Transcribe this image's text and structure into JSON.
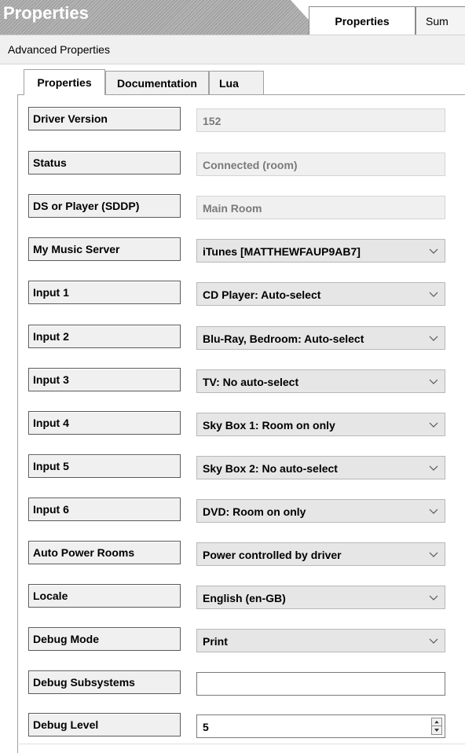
{
  "header": {
    "title": "Properties",
    "tabs": [
      {
        "label": "Properties",
        "active": true
      },
      {
        "label": "Sum",
        "active": false
      }
    ]
  },
  "subheader": {
    "label": "Advanced Properties"
  },
  "inner_tabs": [
    {
      "label": "Properties",
      "active": true
    },
    {
      "label": "Documentation",
      "active": false
    },
    {
      "label": "Lua",
      "active": false
    }
  ],
  "properties": [
    {
      "label": "Driver Version",
      "value": "152",
      "control": "readonly"
    },
    {
      "label": "Status",
      "value": "Connected (room)",
      "control": "readonly"
    },
    {
      "label": "DS or Player (SDDP)",
      "value": "Main Room",
      "control": "readonly"
    },
    {
      "label": "My Music Server",
      "value": "iTunes [MATTHEWFAUP9AB7]",
      "control": "select"
    },
    {
      "label": "Input 1",
      "value": "CD Player: Auto-select",
      "control": "select"
    },
    {
      "label": "Input 2",
      "value": "Blu-Ray, Bedroom: Auto-select",
      "control": "select"
    },
    {
      "label": "Input 3",
      "value": "TV: No auto-select",
      "control": "select"
    },
    {
      "label": "Input 4",
      "value": "Sky Box 1: Room on only",
      "control": "select"
    },
    {
      "label": "Input 5",
      "value": "Sky Box 2: No auto-select",
      "control": "select"
    },
    {
      "label": "Input 6",
      "value": "DVD: Room on only",
      "control": "select"
    },
    {
      "label": "Auto Power Rooms",
      "value": "Power controlled by driver",
      "control": "select"
    },
    {
      "label": "Locale",
      "value": "English (en-GB)",
      "control": "select"
    },
    {
      "label": "Debug Mode",
      "value": "Print",
      "control": "select"
    },
    {
      "label": "Debug Subsystems",
      "value": "",
      "control": "text"
    },
    {
      "label": "Debug Level",
      "value": "5",
      "control": "spinner"
    }
  ],
  "icons": {
    "dropdown": "chevron-down-icon",
    "spinner_up": "spinner-up-icon",
    "spinner_down": "spinner-down-icon"
  },
  "colors": {
    "title_band": "#a8a8a8",
    "readonly_bg": "#f0f0f0",
    "readonly_text": "#7a7a7a",
    "select_bg": "#e6e6e6"
  }
}
